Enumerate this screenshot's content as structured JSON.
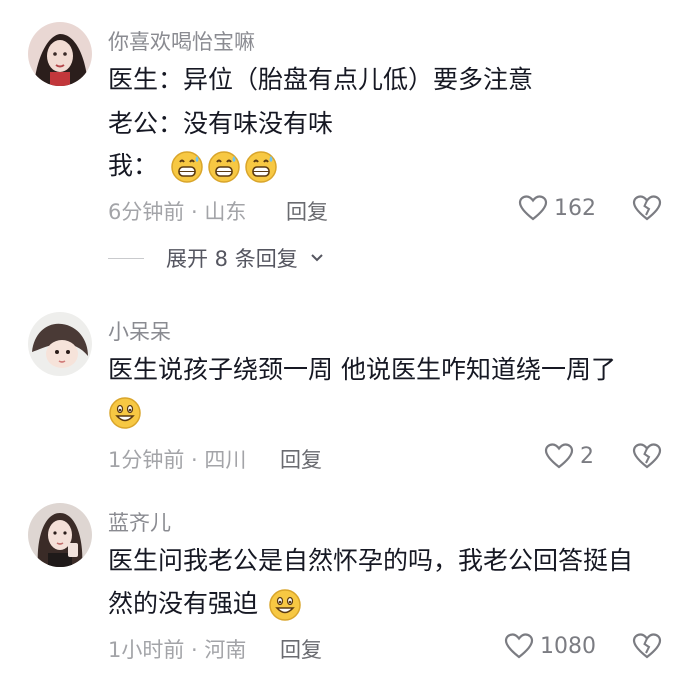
{
  "comments": [
    {
      "username": "你喜欢喝怡宝嘛",
      "lines": [
        "医生：异位（胎盘有点儿低）要多注意",
        "老公：没有味没有味",
        "我："
      ],
      "emoji": "grinning-sweat-emoji",
      "emoji_count": 3,
      "time_location": "6分钟前 · 山东",
      "reply_label": "回复",
      "likes": "162",
      "expand_label": "展开 8 条回复"
    },
    {
      "username": "小呆呆",
      "lines": [
        "医生说孩子绕颈一周 他说医生咋知道绕一周了"
      ],
      "emoji": "grinning-emoji",
      "time_location": "1分钟前 · 四川",
      "reply_label": "回复",
      "likes": "2"
    },
    {
      "username": "蓝齐儿",
      "lines": [
        "医生问我老公是自然怀孕的吗，我老公回答挺自",
        "然的没有强迫"
      ],
      "emoji": "grinning-emoji",
      "time_location": "1小时前 · 河南",
      "reply_label": "回复",
      "likes": "1080"
    }
  ],
  "colors": {
    "text": "#161823",
    "username": "#8a8b91",
    "meta": "#a3a4a8",
    "emoji_face": "#f7c843"
  }
}
